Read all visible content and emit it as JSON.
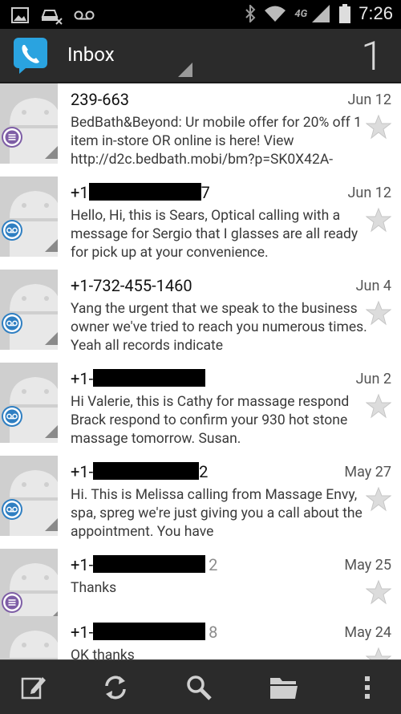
{
  "status_bar": {
    "time": "7:26",
    "network": "4G",
    "icons": [
      "image-icon",
      "car-missed-icon",
      "voicemail-icon",
      "bluetooth-icon",
      "wifi-icon",
      "signal-icon",
      "battery-icon"
    ]
  },
  "action_bar": {
    "title": "Inbox",
    "count": "1",
    "app_icon": "phone-chat-icon"
  },
  "messages": [
    {
      "sender": "239-663",
      "sender_tail": "",
      "sender_tail_grey": "",
      "redacted": false,
      "date": "Jun 12",
      "badge": "purple",
      "preview": "BedBath&Beyond: Ur mobile offer for 20% off 1 item in-store OR online is here! View http://d2c.bedbath.mobi/bm?p=SK0X42A-"
    },
    {
      "sender": "+1",
      "sender_tail": "7",
      "sender_tail_grey": "",
      "redacted": true,
      "date": "Jun 12",
      "badge": "blue",
      "preview": "Hello, Hi, this is Sears, Optical calling with a message for Sergio that I glasses are all ready for pick up at your convenience."
    },
    {
      "sender": "+1-732-455-1460",
      "sender_tail": "",
      "sender_tail_grey": "",
      "redacted": false,
      "date": "Jun 4",
      "badge": "blue",
      "preview": "Yang the urgent that we speak to the business owner we've tried to reach you numerous times. Yeah all records indicate"
    },
    {
      "sender": "+1-",
      "sender_tail": "",
      "sender_tail_grey": "",
      "redacted": true,
      "date": "Jun 2",
      "badge": "blue",
      "preview": "Hi Valerie, this is Cathy for massage respond Brack respond to confirm your 930 hot stone massage tomorrow. Susan."
    },
    {
      "sender": "+1-",
      "sender_tail": "2",
      "sender_tail_grey": "",
      "redacted": true,
      "date": "May 27",
      "badge": "blue",
      "preview": "Hi. This is Melissa calling from Massage Envy, spa, spreg we're just giving you a call about the appointment. You have"
    },
    {
      "sender": "+1-",
      "sender_tail": "",
      "sender_tail_grey": "2",
      "redacted": true,
      "date": "May 25",
      "badge": "purple",
      "preview": "Thanks"
    },
    {
      "sender": "+1-",
      "sender_tail": "",
      "sender_tail_grey": "8",
      "redacted": true,
      "date": "May 24",
      "badge": "",
      "preview": "OK thanks"
    }
  ],
  "bottom_bar": {
    "buttons": [
      "compose-icon",
      "refresh-icon",
      "search-icon",
      "folder-icon",
      "overflow-menu-icon"
    ]
  }
}
